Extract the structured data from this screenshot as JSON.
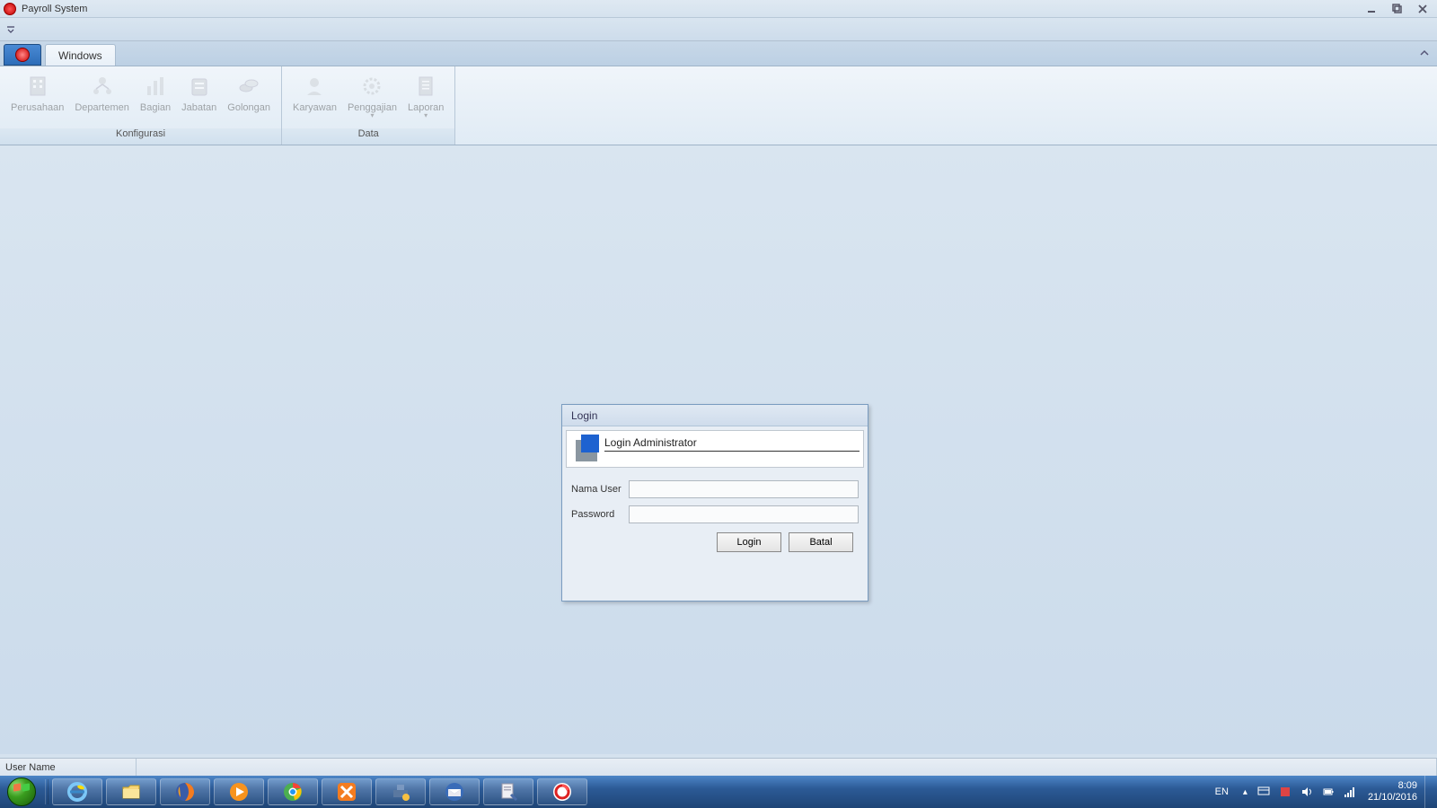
{
  "app": {
    "title": "Payroll System"
  },
  "ribbon": {
    "tab_label": "Windows",
    "groups": [
      {
        "label": "Konfigurasi",
        "items": [
          {
            "label": "Perusahaan",
            "icon": "building"
          },
          {
            "label": "Departemen",
            "icon": "org"
          },
          {
            "label": "Bagian",
            "icon": "bars"
          },
          {
            "label": "Jabatan",
            "icon": "badge"
          },
          {
            "label": "Golongan",
            "icon": "coins"
          }
        ]
      },
      {
        "label": "Data",
        "items": [
          {
            "label": "Karyawan",
            "icon": "person"
          },
          {
            "label": "Penggajian",
            "icon": "gear",
            "dropdown": true
          },
          {
            "label": "Laporan",
            "icon": "report",
            "dropdown": true
          }
        ]
      }
    ]
  },
  "login": {
    "window_title": "Login",
    "header_title": "Login Administrator",
    "label_user": "Nama User",
    "label_password": "Password",
    "value_user": "",
    "value_password": "",
    "btn_login": "Login",
    "btn_cancel": "Batal"
  },
  "statusbar": {
    "label": "User Name",
    "value": ""
  },
  "tray": {
    "lang": "EN",
    "time": "8:09",
    "date": "21/10/2016"
  }
}
